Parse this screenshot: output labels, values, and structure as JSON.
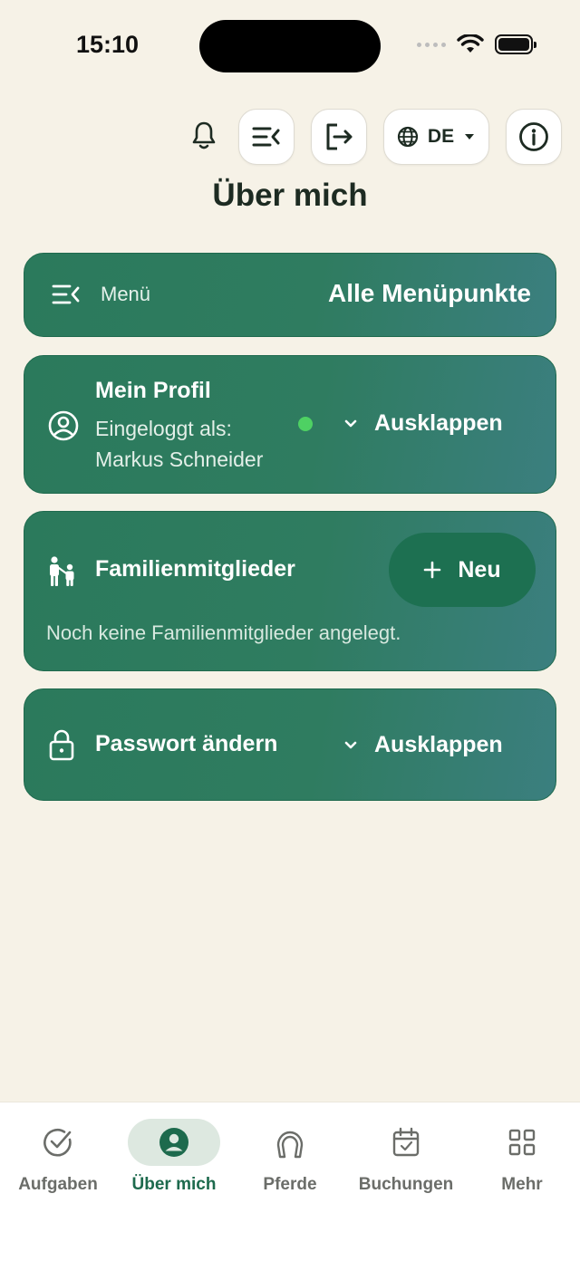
{
  "status_bar": {
    "time": "15:10"
  },
  "toolbar": {
    "language": "DE"
  },
  "page": {
    "title": "Über mich"
  },
  "menu_card": {
    "label": "Menü",
    "action": "Alle Menüpunkte"
  },
  "profile_card": {
    "title": "Mein Profil",
    "logged_in_label": "Eingeloggt als:",
    "user_name": "Markus Schneider",
    "expand_label": "Ausklappen",
    "status_color": "#4ed163"
  },
  "family_card": {
    "title": "Familienmitglieder",
    "new_label": "Neu",
    "empty_text": "Noch keine Familienmitglieder angelegt."
  },
  "password_card": {
    "title": "Passwort ändern",
    "expand_label": "Ausklappen"
  },
  "tab_bar": {
    "tabs": [
      {
        "label": "Aufgaben",
        "icon": "check-circle-icon",
        "active": false
      },
      {
        "label": "Über mich",
        "icon": "user-circle-icon",
        "active": true
      },
      {
        "label": "Pferde",
        "icon": "horseshoe-icon",
        "active": false
      },
      {
        "label": "Buchungen",
        "icon": "calendar-icon",
        "active": false
      },
      {
        "label": "Mehr",
        "icon": "grid-icon",
        "active": false
      }
    ]
  },
  "colors": {
    "accent": "#1d6a4d",
    "card": "#2b7a5c",
    "background": "#f6f2e7"
  }
}
